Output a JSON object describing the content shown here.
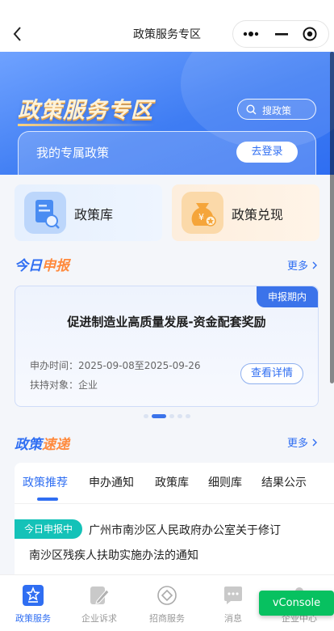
{
  "navbar": {
    "title": "政策服务专区"
  },
  "hero": {
    "title": "政策服务专区",
    "search_placeholder": "搜政策",
    "my_policy": "我的专属政策",
    "login_label": "去登录"
  },
  "categories": [
    {
      "label": "政策库"
    },
    {
      "label": "政策兑现"
    }
  ],
  "today_apply": {
    "title_a": "今日",
    "title_b": "申报",
    "more": "更多",
    "card": {
      "badge": "申报期内",
      "title": "促进制造业高质量发展-资金配套奖励",
      "date_label": "申办时间：",
      "date_value": "2025-09-08至2025-09-26",
      "target_label": "扶持对象：",
      "target_value": "企业",
      "detail_label": "查看详情"
    },
    "carousel": {
      "count": 5,
      "active_index": 1
    }
  },
  "policy_express": {
    "title_a": "政策",
    "title_b": "速递",
    "more": "更多",
    "tabs": [
      {
        "label": "政策推荐"
      },
      {
        "label": "申办通知"
      },
      {
        "label": "政策库"
      },
      {
        "label": "细则库"
      },
      {
        "label": "结果公示"
      }
    ],
    "active_tab": 0,
    "news": {
      "tag": "今日申报中",
      "line1": "广州市南沙区人民政府办公室关于修订",
      "line2": "南沙区残疾人扶助实施办法的通知"
    }
  },
  "tabbar": {
    "items": [
      {
        "label": "政策服务",
        "icon": "policy-service-icon"
      },
      {
        "label": "企业诉求",
        "icon": "edit-icon"
      },
      {
        "label": "招商服务",
        "icon": "diamond-icon"
      },
      {
        "label": "消息",
        "icon": "chat-icon"
      },
      {
        "label": "企业中心",
        "icon": "user-center-icon"
      }
    ],
    "active_index": 0
  },
  "vconsole": {
    "label": "vConsole"
  },
  "colors": {
    "primary": "#2f6ef2",
    "accent_orange": "#ff8a3d",
    "tag_teal": "#14c2b8",
    "vconsole_green": "#07c160"
  }
}
